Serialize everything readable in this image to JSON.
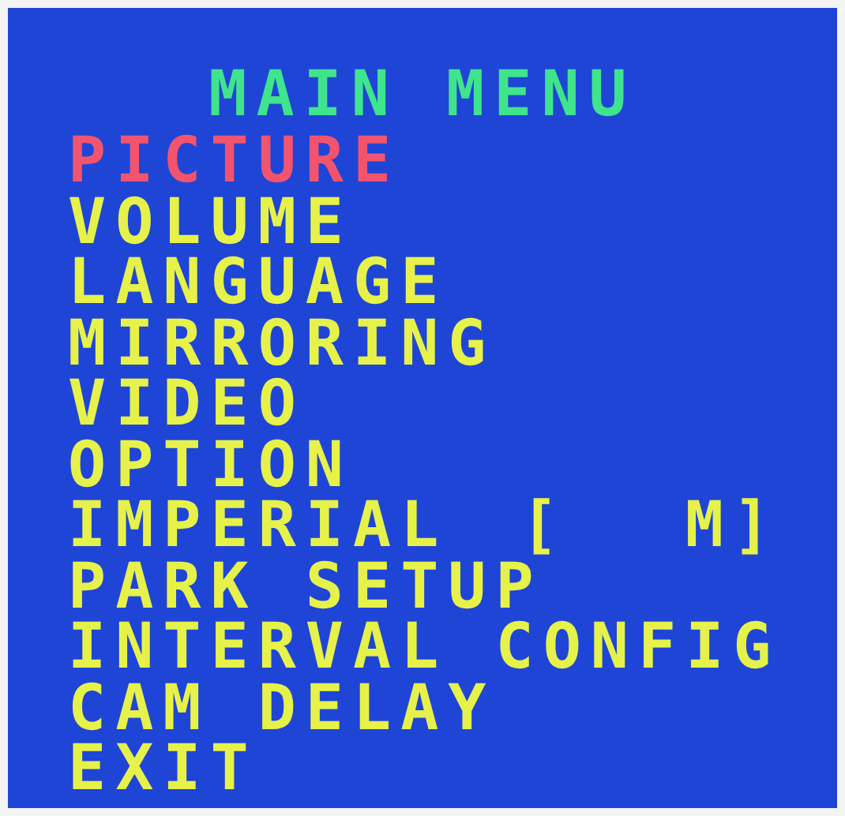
{
  "title": "MAIN MENU",
  "items": [
    {
      "label": "PICTURE",
      "selected": true
    },
    {
      "label": "VOLUME",
      "selected": false
    },
    {
      "label": "LANGUAGE",
      "selected": false
    },
    {
      "label": "MIRRORING",
      "selected": false
    },
    {
      "label": "VIDEO",
      "selected": false
    },
    {
      "label": "OPTION",
      "selected": false
    },
    {
      "label": "IMPERIAL",
      "value": "[ M]",
      "selected": false
    },
    {
      "label": "PARK SETUP",
      "selected": false
    },
    {
      "label": "INTERVAL CONFIG",
      "selected": false
    },
    {
      "label": "CAM DELAY",
      "selected": false
    },
    {
      "label": "EXIT",
      "selected": false
    }
  ]
}
